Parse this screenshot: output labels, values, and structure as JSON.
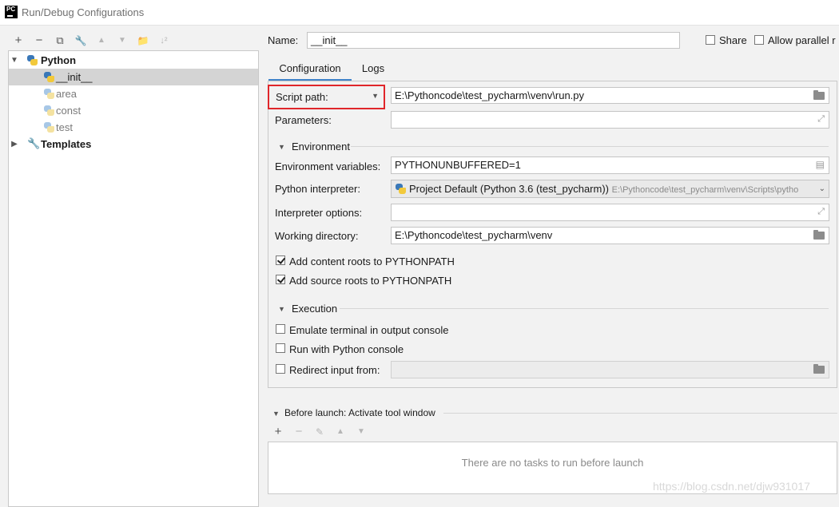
{
  "window": {
    "title": "Run/Debug Configurations",
    "app_icon_text": "PC"
  },
  "toolbar": {
    "add": "+",
    "remove": "−",
    "copy": "⧉",
    "edit": "🔧",
    "up": "▲",
    "down": "▼",
    "folder": "📁",
    "sort": "↓²"
  },
  "tree": {
    "python_label": "Python",
    "items": [
      "__init__",
      "area",
      "const",
      "test"
    ],
    "templates_label": "Templates"
  },
  "header": {
    "name_label": "Name:",
    "name_value": "__init__",
    "share_label": "Share",
    "allow_parallel_label": "Allow parallel r"
  },
  "tabs": [
    "Configuration",
    "Logs"
  ],
  "config": {
    "script_path_label": "Script path:",
    "script_path_value": "E:\\Pythoncode\\test_pycharm\\venv\\run.py",
    "parameters_label": "Parameters:",
    "parameters_value": "",
    "environment_section": "Environment",
    "env_vars_label": "Environment variables:",
    "env_vars_value": "PYTHONUNBUFFERED=1",
    "interpreter_label": "Python interpreter:",
    "interpreter_value": "Project Default (Python 3.6 (test_pycharm))",
    "interpreter_path": "E:\\Pythoncode\\test_pycharm\\venv\\Scripts\\pytho",
    "interp_options_label": "Interpreter options:",
    "interp_options_value": "",
    "working_dir_label": "Working directory:",
    "working_dir_value": "E:\\Pythoncode\\test_pycharm\\venv",
    "add_content_roots_label": "Add content roots to PYTHONPATH",
    "add_source_roots_label": "Add source roots to PYTHONPATH",
    "execution_section": "Execution",
    "emulate_terminal_label": "Emulate terminal in output console",
    "run_python_console_label": "Run with Python console",
    "redirect_input_label": "Redirect input from:"
  },
  "before_launch": {
    "title": "Before launch: Activate tool window",
    "empty_text": "There are no tasks to run before launch"
  },
  "watermark": "https://blog.csdn.net/djw931017",
  "colors": {
    "highlight_border": "#e0262a",
    "tab_underline": "#4083c9",
    "selection": "#d4d4d4"
  }
}
